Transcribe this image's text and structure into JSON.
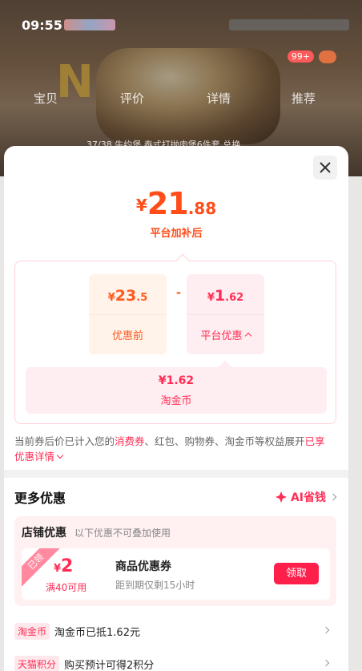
{
  "background": {
    "time": "09:55",
    "tabs": [
      "宝贝",
      "评价",
      "详情",
      "推荐"
    ],
    "caption": "37/38 牛约堡 泰式打抛肉堡6件套 总换",
    "badge": "99+"
  },
  "sheet": {
    "price": {
      "currency": "¥",
      "integer": "21",
      "decimal": ".88"
    },
    "price_label": "平台加补后",
    "before": {
      "currency": "¥",
      "integer": "23",
      "decimal": ".5",
      "label": "优惠前"
    },
    "operator": "-",
    "promo": {
      "currency": "¥",
      "integer": "1",
      "decimal": ".62",
      "label": "平台优惠"
    },
    "coin": {
      "value": "¥1.62",
      "label": "淘金币"
    },
    "note": {
      "part1": "当前券后价已计入您的",
      "highlight": "消费券",
      "part2": "、红包、购物券、淘金币等权益展开",
      "link": "已享优惠详情"
    },
    "more": {
      "title": "更多优惠",
      "ai_label": "AI省钱"
    },
    "store": {
      "title": "店铺优惠",
      "subtitle": "以下优惠不可叠加使用",
      "coupon": {
        "ribbon": "已领",
        "currency": "¥",
        "amount": "2",
        "condition": "满40可用",
        "name": "商品优惠券",
        "expiry": "距到期仅剩15小时",
        "button": "领取"
      }
    },
    "rows": [
      {
        "tag": "淘金币",
        "text": "淘金币已抵1.62元"
      },
      {
        "tag": "天猫积分",
        "text": "购买预计可得2积分"
      }
    ]
  },
  "colors": {
    "accent": "#ff2d55",
    "orange": "#ff4d1a",
    "claim": "#ff1f4b"
  }
}
